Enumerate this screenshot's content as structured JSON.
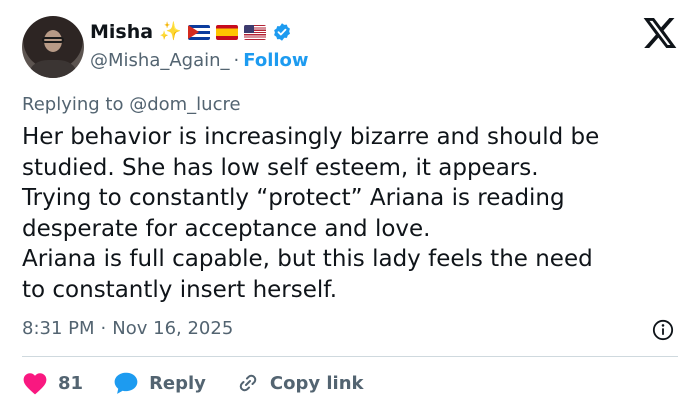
{
  "author": {
    "display_name": "Misha",
    "badges": [
      "sparkles-icon",
      "flag-cuba-icon",
      "flag-spain-icon",
      "flag-usa-icon",
      "verified-badge-icon"
    ],
    "handle": "@Misha_Again_",
    "separator": "·",
    "follow_label": "Follow"
  },
  "replying_to": "Replying to @dom_lucre",
  "tweet_text": "Her behavior is increasingly bizarre and should be\nstudied. She has low self esteem, it appears.\nTrying to constantly “protect” Ariana is reading\ndesperate for acceptance and love.\nAriana is full capable, but this lady feels the need\nto constantly insert herself.",
  "timestamp": {
    "time": "8:31 PM",
    "separator": "·",
    "date": "Nov 16, 2025"
  },
  "actions": {
    "like_count": "81",
    "reply_label": "Reply",
    "copy_link_label": "Copy link"
  },
  "colors": {
    "accent": "#1d9bf0",
    "like": "#f91880",
    "muted_text": "#536471",
    "primary_text": "#0f1419",
    "divider": "#cfd9de"
  }
}
